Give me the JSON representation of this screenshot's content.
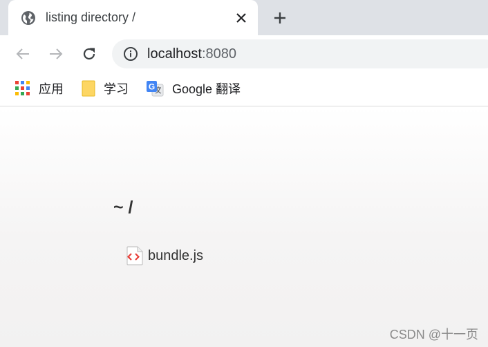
{
  "tab": {
    "title": "listing directory /",
    "icon": "globe-icon",
    "close_icon": "close-icon"
  },
  "newtab": {
    "icon": "plus-icon"
  },
  "toolbar": {
    "back_icon": "arrow-left-icon",
    "forward_icon": "arrow-right-icon",
    "reload_icon": "reload-icon",
    "info_icon": "info-icon",
    "url": {
      "host": "localhost",
      "port": ":8080"
    }
  },
  "bookmarks": [
    {
      "label": "应用",
      "icon": "apps-grid-icon"
    },
    {
      "label": "学习",
      "icon": "folder-icon"
    },
    {
      "label": "Google 翻译",
      "icon": "google-translate-icon"
    }
  ],
  "listing": {
    "heading": "~ /",
    "files": [
      {
        "name": "bundle.js",
        "icon": "js-file-icon"
      }
    ]
  },
  "watermark": "CSDN @十一页",
  "colors": {
    "tabstrip": "#dee1e6",
    "omnibox": "#f1f3f4",
    "text": "#333333"
  }
}
